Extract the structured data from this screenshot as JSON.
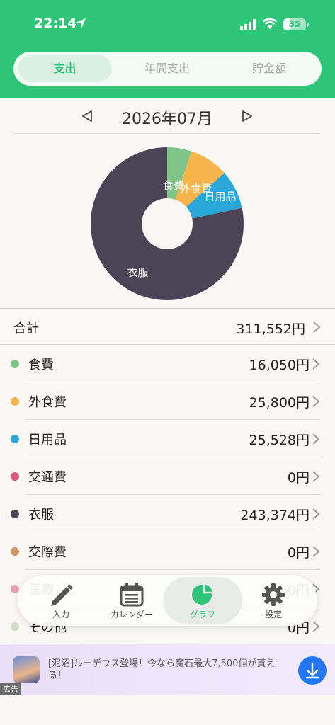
{
  "status": {
    "time": "22:14",
    "battery": "35",
    "battery_level": 0.35
  },
  "segment": {
    "tabs": [
      "支出",
      "年間支出",
      "貯金額"
    ],
    "active_index": 0
  },
  "month": {
    "title": "2026年07月",
    "prev": "◁",
    "next": "▷"
  },
  "chart_data": {
    "type": "pie",
    "variant": "donut",
    "slice_labels": [
      "食費",
      "外食費",
      "日用品",
      "衣服"
    ],
    "slices": [
      {
        "name": "食費",
        "value": 16050,
        "color": "#7fc58a"
      },
      {
        "name": "外食費",
        "value": 25800,
        "color": "#f7b44a"
      },
      {
        "name": "日用品",
        "value": 25528,
        "color": "#2ba6d9"
      },
      {
        "name": "交通費",
        "value": 0,
        "color": "#e0567f"
      },
      {
        "name": "衣服",
        "value": 243374,
        "color": "#4a4456"
      },
      {
        "name": "交際費",
        "value": 0,
        "color": "#cf9462"
      }
    ]
  },
  "total": {
    "label": "合計",
    "value": "311,552円"
  },
  "categories": [
    {
      "name": "食費",
      "value": "16,050円",
      "color": "#7fc58a"
    },
    {
      "name": "外食費",
      "value": "25,800円",
      "color": "#f7b44a"
    },
    {
      "name": "日用品",
      "value": "25,528円",
      "color": "#2ba6d9"
    },
    {
      "name": "交通費",
      "value": "0円",
      "color": "#e0567f"
    },
    {
      "name": "衣服",
      "value": "243,374円",
      "color": "#4a4456"
    },
    {
      "name": "交際費",
      "value": "0円",
      "color": "#cf9462"
    },
    {
      "name": "医療",
      "value": "0円",
      "color": "#e7a3b1"
    },
    {
      "name": "その他",
      "value": "0円",
      "color": "#cfe0c8"
    }
  ],
  "tabbar": [
    {
      "label": "入力",
      "icon": "pencil-icon"
    },
    {
      "label": "カレンダー",
      "icon": "calendar-icon"
    },
    {
      "label": "グラフ",
      "icon": "pie-chart-icon"
    },
    {
      "label": "設定",
      "icon": "gear-icon"
    }
  ],
  "ad": {
    "text": "[泥沼]ルーデウス登場！今なら魔石最大7,500個が貰える！",
    "tag": "広告"
  },
  "colors": {
    "brand": "#2fc578",
    "ad_button": "#2477f2"
  }
}
